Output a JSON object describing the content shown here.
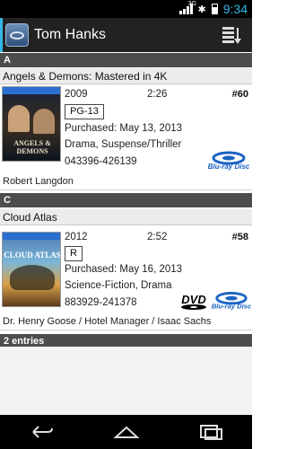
{
  "status_bar": {
    "network": "3G",
    "clock": "9:34"
  },
  "action_bar": {
    "title": "Tom Hanks"
  },
  "sections": [
    {
      "letter": "A"
    },
    {
      "letter": "C"
    }
  ],
  "movies": [
    {
      "title": "Angels & Demons: Mastered in 4K",
      "year": "2009",
      "runtime": "2:26",
      "number": "#60",
      "rating": "PG-13",
      "purchased": "Purchased: May 13, 2013",
      "genres": "Drama, Suspense/Thriller",
      "upc": "043396-426139",
      "role": "Robert Langdon",
      "formats": [
        "Blu-ray"
      ]
    },
    {
      "title": "Cloud Atlas",
      "year": "2012",
      "runtime": "2:52",
      "number": "#58",
      "rating": "R",
      "purchased": "Purchased: May 16, 2013",
      "genres": "Science-Fiction, Drama",
      "upc": "883929-241378",
      "role": "Dr. Henry Goose / Hotel Manager / Isaac Sachs",
      "formats": [
        "DVD",
        "Blu-ray"
      ]
    }
  ],
  "footer": {
    "count": "2 entries"
  },
  "icons": {
    "app": "collection-app-icon",
    "sort": "sort-list-icon",
    "back": "back-icon",
    "home": "home-icon",
    "recents": "recent-apps-icon"
  },
  "colors": {
    "accent": "#33b5e5",
    "header": "#4d4d4d",
    "bluray": "#1a63c2"
  }
}
